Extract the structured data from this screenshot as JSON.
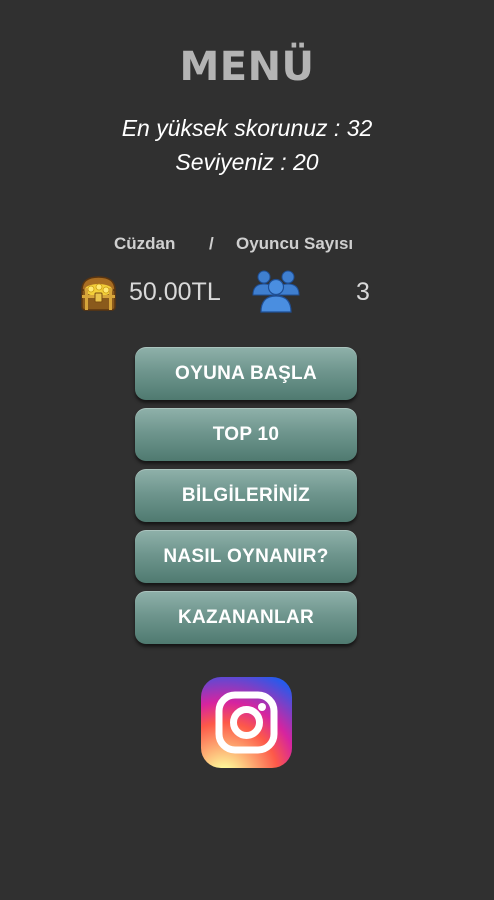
{
  "header": {
    "title": "MENÜ",
    "high_score_text": "En yüksek skorunuz : 32",
    "level_text": "Seviyeniz : 20"
  },
  "stats": {
    "wallet_label": "Cüzdan",
    "separator": "/",
    "players_label": "Oyuncu Sayısı",
    "wallet_value": "50.00TL",
    "players_value": "3",
    "wallet_icon": "treasure-chest-icon",
    "players_icon": "group-users-icon"
  },
  "menu": {
    "start": "OYUNA BAŞLA",
    "top10": "TOP 10",
    "info": "BİLGİLERİNİZ",
    "howto": "NASIL OYNANIR?",
    "winners": "KAZANANLAR"
  },
  "social": {
    "icon": "instagram-icon"
  },
  "colors": {
    "background": "#303030",
    "title": "#b4b4b4",
    "button_top": "#8fb1aa",
    "button_bottom": "#4f7a70",
    "users_icon": "#3f7fd0"
  }
}
